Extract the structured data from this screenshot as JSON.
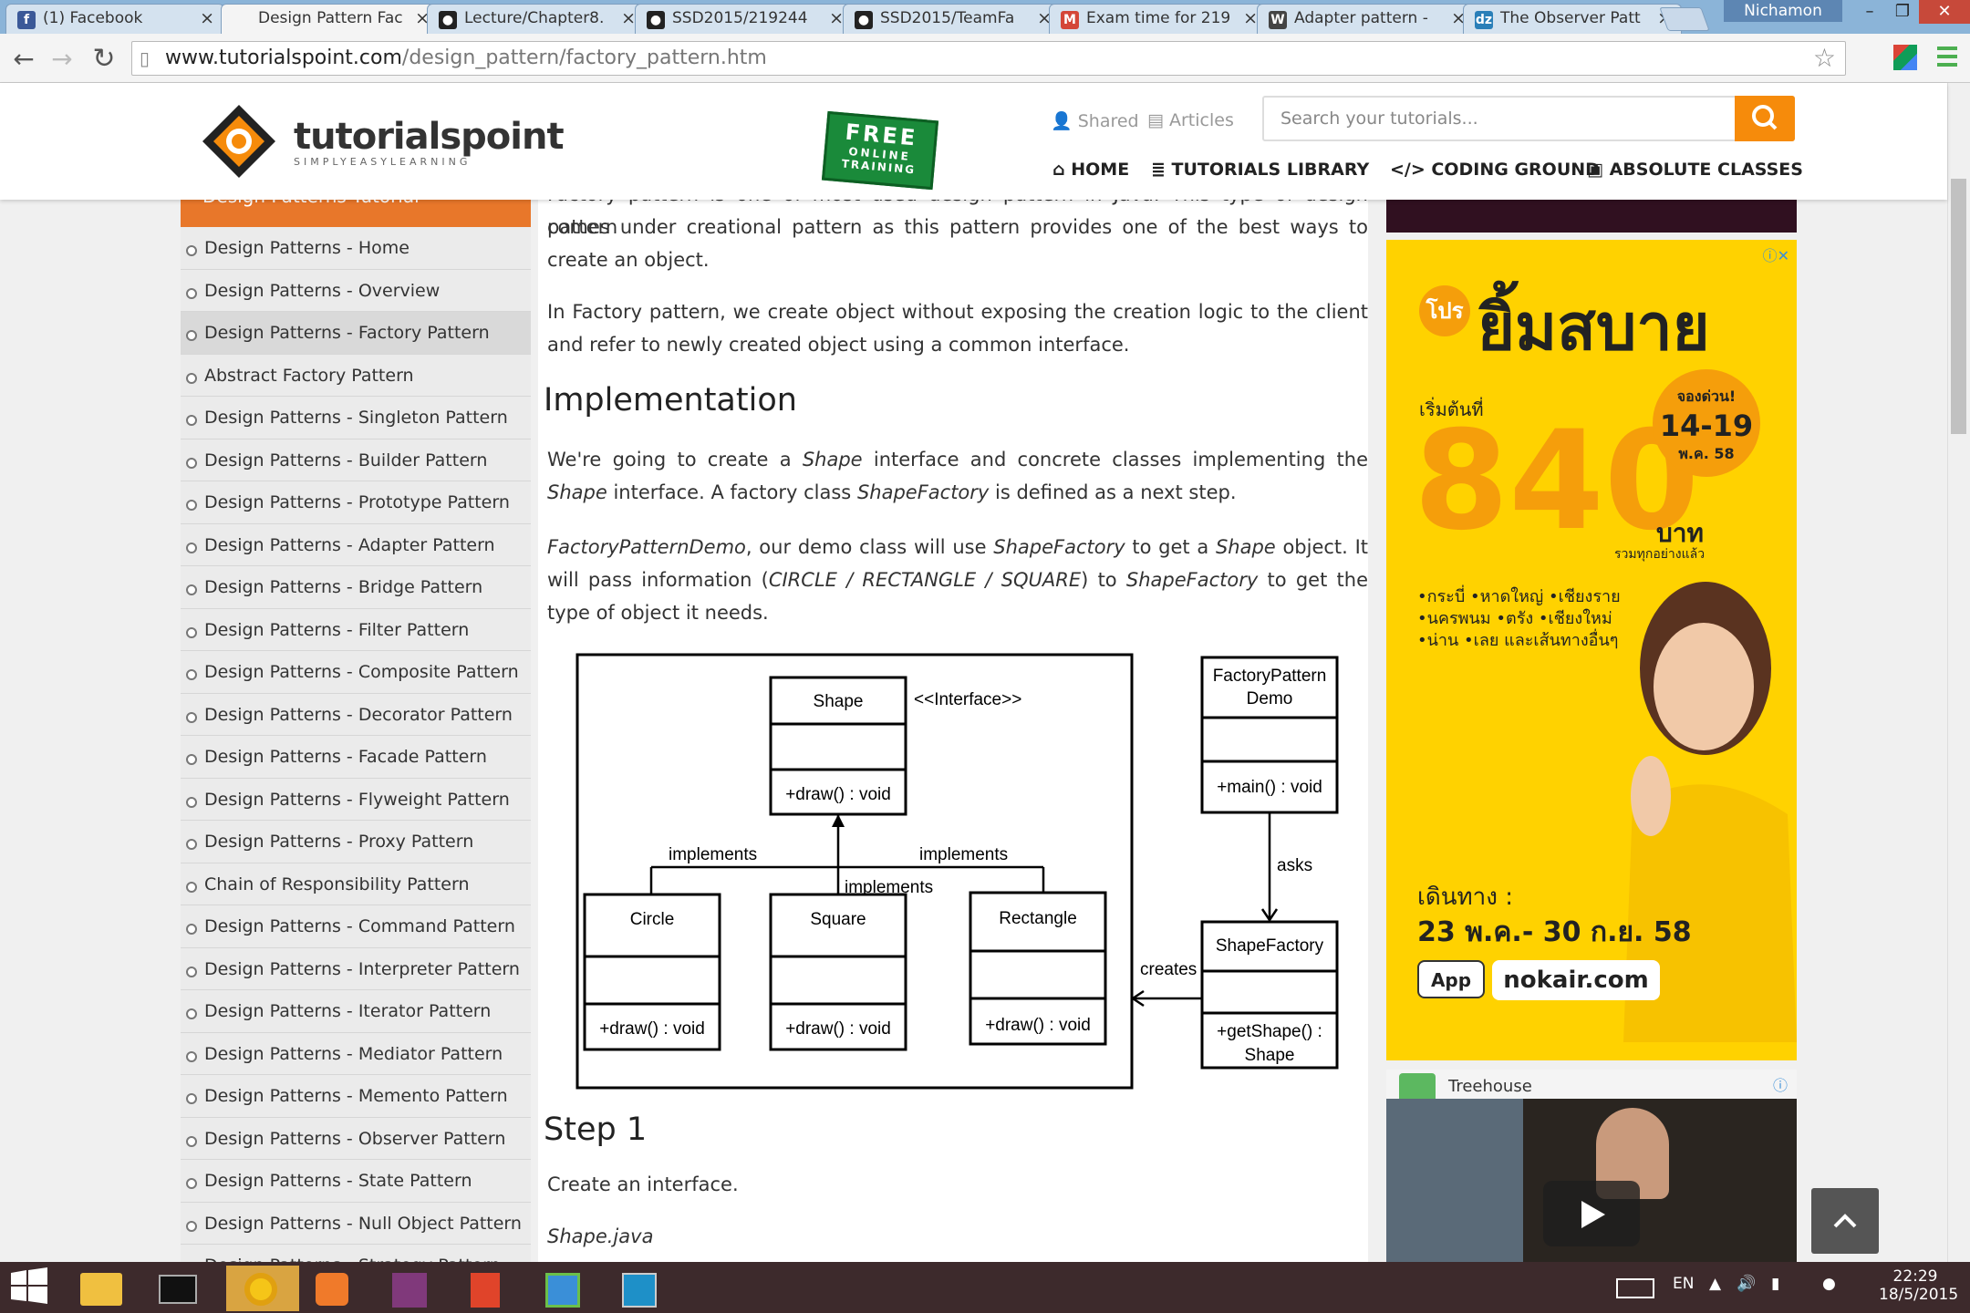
{
  "browser": {
    "tabs": [
      {
        "title": "(1) Facebook",
        "icon": "facebook-icon",
        "icon_char": "f",
        "icon_color": "#3b5998"
      },
      {
        "title": "Design Pattern Fac",
        "icon": "tutorialspoint-icon",
        "icon_char": "",
        "icon_color": "#f4f4f4",
        "active": true
      },
      {
        "title": "Lecture/Chapter8.",
        "icon": "github-icon",
        "icon_char": "●",
        "icon_color": "#222"
      },
      {
        "title": "SSD2015/219244",
        "icon": "github-icon",
        "icon_char": "●",
        "icon_color": "#222"
      },
      {
        "title": "SSD2015/TeamFa",
        "icon": "github-icon",
        "icon_char": "●",
        "icon_color": "#222"
      },
      {
        "title": "Exam time for 219",
        "icon": "gmail-icon",
        "icon_char": "M",
        "icon_color": "#d44638"
      },
      {
        "title": "Adapter pattern -",
        "icon": "wikipedia-icon",
        "icon_char": "W",
        "icon_color": "#444"
      },
      {
        "title": "The Observer Patt",
        "icon": "dzone-icon",
        "icon_char": "dz",
        "icon_color": "#2a7fb8"
      }
    ],
    "tab_close": "×",
    "user": "Nichamon",
    "url_domain": "www.tutorialspoint.com",
    "url_path": "/design_pattern/factory_pattern.htm"
  },
  "header": {
    "logo_text": "tutorialspoint",
    "logo_tagline": "SIMPLYEASYLEARNING",
    "free_badge": [
      "FREE",
      "ONLINE",
      "TRAINING"
    ],
    "shared": "Shared",
    "articles": "Articles",
    "search_placeholder": "Search your tutorials...",
    "nav": [
      "HOME",
      "TUTORIALS LIBRARY",
      "CODING GROUND",
      "ABSOLUTE CLASSES"
    ]
  },
  "sidebar": {
    "header": "Design Patterns Tutorial",
    "items": [
      "Design Patterns - Home",
      "Design Patterns - Overview",
      "Design Patterns - Factory Pattern",
      "Abstract Factory Pattern",
      "Design Patterns - Singleton Pattern",
      "Design Patterns - Builder Pattern",
      "Design Patterns - Prototype Pattern",
      "Design Patterns - Adapter Pattern",
      "Design Patterns - Bridge Pattern",
      "Design Patterns - Filter Pattern",
      "Design Patterns - Composite Pattern",
      "Design Patterns - Decorator Pattern",
      "Design Patterns - Facade Pattern",
      "Design Patterns - Flyweight Pattern",
      "Design Patterns - Proxy Pattern",
      "Chain of Responsibility Pattern",
      "Design Patterns - Command Pattern",
      "Design Patterns - Interpreter Pattern",
      "Design Patterns - Iterator Pattern",
      "Design Patterns - Mediator Pattern",
      "Design Patterns - Memento Pattern",
      "Design Patterns - Observer Pattern",
      "Design Patterns - State Pattern",
      "Design Patterns - Null Object Pattern",
      "Design Patterns - Strategy Pattern"
    ],
    "active_index": 2
  },
  "content": {
    "intro_partial": "Factory pattern is one of most used design pattern in Java. This type of design pattern",
    "p1": "comes under creational pattern as this pattern provides one of the best ways to create an object.",
    "p2": "In Factory pattern, we create object without exposing the creation logic to the client and refer to newly created object using a common interface.",
    "h_impl": "Implementation",
    "p3_a": "We're going to create a ",
    "p3_b": "Shape",
    "p3_c": " interface and concrete classes implementing the ",
    "p3_d": "Shape",
    "p3_e": " interface. A factory class ",
    "p3_f": "ShapeFactory",
    "p3_g": " is defined as a next step.",
    "p4_a": "FactoryPatternDemo",
    "p4_b": ", our demo class will use ",
    "p4_c": "ShapeFactory",
    "p4_d": " to get a ",
    "p4_e": "Shape",
    "p4_f": " object. It will pass information (",
    "p4_g": "CIRCLE / RECTANGLE / SQUARE",
    "p4_h": ") to ",
    "p4_i": "ShapeFactory",
    "p4_j": " to get the type of object it needs.",
    "h_step": "Step 1",
    "p5": "Create an interface.",
    "p6": "Shape.java"
  },
  "diagram": {
    "shape": "Shape",
    "interface": "<<Interface>>",
    "draw": "+draw() : void",
    "circle": "Circle",
    "square": "Square",
    "rectangle": "Rectangle",
    "implements": "implements",
    "demo_line1": "FactoryPattern",
    "demo_line2": "Demo",
    "main": "+main() : void",
    "asks": "asks",
    "factory": "ShapeFactory",
    "creates": "creates",
    "getshape_line1": "+getShape() :",
    "getshape_line2": "Shape"
  },
  "ads": {
    "thai_title": "ยิ้มสบาย",
    "promo": "โปร",
    "price_prefix": "เริ่มต้นที่",
    "price": "840",
    "baht": "บาท",
    "tax": "รวมทุกอย่างแล้ว",
    "booking": "จองด่วน!",
    "booking_dates": "14-19",
    "booking_month": "พ.ค. 58",
    "routes": [
      "•กระบี่ •หาดใหญ่ •เชียงราย",
      "•นครพนม •ตรัง •เชียงใหม่",
      "•น่าน •เลย และเส้นทางอื่นๆ"
    ],
    "travel_label": "เดินทาง :",
    "travel_dates": "23 พ.ค.- 30 ก.ย. 58",
    "app_label": "App",
    "site": "nokair.com",
    "treehouse": "Treehouse"
  },
  "taskbar": {
    "lang": "EN",
    "time": "22:29",
    "date": "18/5/2015"
  }
}
